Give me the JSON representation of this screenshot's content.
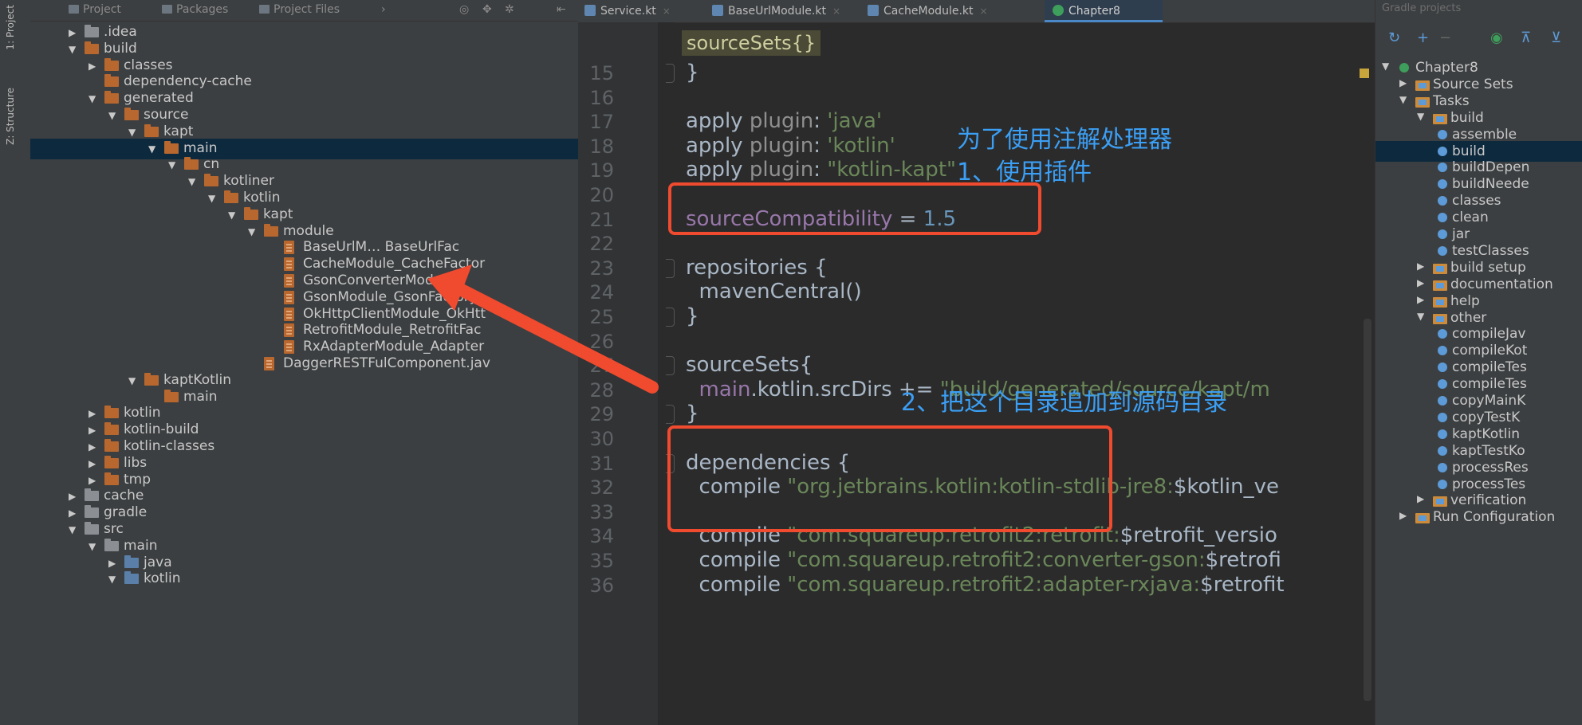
{
  "left_strip": {
    "project_label": "1: Project",
    "structure_label": "Z: Structure"
  },
  "project_panel": {
    "tabs": [
      "Project",
      "Packages",
      "Project Files"
    ],
    "tree": [
      {
        "label": ".idea",
        "arrow": "▶",
        "folder": "gray"
      },
      {
        "label": "build",
        "arrow": "▼",
        "folder": "orange"
      },
      {
        "label": "classes",
        "arrow": "▶",
        "folder": "orange"
      },
      {
        "label": "dependency-cache",
        "arrow": "",
        "folder": "orange"
      },
      {
        "label": "generated",
        "arrow": "▼",
        "folder": "orange"
      },
      {
        "label": "source",
        "arrow": "▼",
        "folder": "orange"
      },
      {
        "label": "kapt",
        "arrow": "▼",
        "folder": "orange"
      },
      {
        "label": "main",
        "arrow": "▼",
        "folder": "orange",
        "selected": true
      },
      {
        "label": "cn",
        "arrow": "▼",
        "folder": "orange"
      },
      {
        "label": "kotliner",
        "arrow": "▼",
        "folder": "orange"
      },
      {
        "label": "kotlin",
        "arrow": "▼",
        "folder": "orange"
      },
      {
        "label": "kapt",
        "arrow": "▼",
        "folder": "orange"
      },
      {
        "label": "module",
        "arrow": "▼",
        "folder": "orange"
      },
      {
        "label": "BaseUrlM… BaseUrlFac",
        "arrow": "",
        "folder": "file"
      },
      {
        "label": "CacheModule_CacheFactor",
        "arrow": "",
        "folder": "file"
      },
      {
        "label": "GsonConverterModule_",
        "arrow": "",
        "folder": "file"
      },
      {
        "label": "GsonModule_GsonFactory.",
        "arrow": "",
        "folder": "file"
      },
      {
        "label": "OkHttpClientModule_OkHtt",
        "arrow": "",
        "folder": "file"
      },
      {
        "label": "RetrofitModule_RetrofitFac",
        "arrow": "",
        "folder": "file"
      },
      {
        "label": "RxAdapterModule_Adapter",
        "arrow": "",
        "folder": "file"
      },
      {
        "label": "DaggerRESTFulComponent.jav",
        "arrow": "",
        "folder": "file"
      },
      {
        "label": "kaptKotlin",
        "arrow": "▼",
        "folder": "orange"
      },
      {
        "label": "main",
        "arrow": "",
        "folder": "orange"
      },
      {
        "label": "kotlin",
        "arrow": "▶",
        "folder": "orange"
      },
      {
        "label": "kotlin-build",
        "arrow": "▶",
        "folder": "orange"
      },
      {
        "label": "kotlin-classes",
        "arrow": "▶",
        "folder": "orange"
      },
      {
        "label": "libs",
        "arrow": "▶",
        "folder": "orange"
      },
      {
        "label": "tmp",
        "arrow": "▶",
        "folder": "orange"
      },
      {
        "label": "cache",
        "arrow": "▶",
        "folder": "gray"
      },
      {
        "label": "gradle",
        "arrow": "▶",
        "folder": "gray"
      },
      {
        "label": "src",
        "arrow": "▼",
        "folder": "gray"
      },
      {
        "label": "main",
        "arrow": "▼",
        "folder": "gray"
      },
      {
        "label": "java",
        "arrow": "▶",
        "folder": "blue"
      },
      {
        "label": "kotlin",
        "arrow": "▼",
        "folder": "blue"
      }
    ]
  },
  "editor": {
    "tabs": [
      {
        "label": "Service.kt",
        "active": false
      },
      {
        "label": "BaseUrlModule.kt",
        "active": false
      },
      {
        "label": "CacheModule.kt",
        "active": false
      },
      {
        "label": "Chapter8",
        "active": true
      }
    ],
    "breadcrumb": "sourceSets{}",
    "lines": [
      {
        "num": "15",
        "html": "}"
      },
      {
        "num": "16",
        "html": ""
      },
      {
        "num": "17",
        "html": "apply <span class='c-gray'>plugin</span>: <span class='c-green'>'java'</span>"
      },
      {
        "num": "18",
        "html": "apply <span class='c-gray'>plugin</span>: <span class='c-green'>'kotlin'</span>"
      },
      {
        "num": "19",
        "html": "apply <span class='c-gray'>plugin</span>: <span class='c-green'>\"kotlin-kapt\"</span>"
      },
      {
        "num": "20",
        "html": ""
      },
      {
        "num": "21",
        "html": "<span class='c-purple'>sourceCompatibility</span> = <span class='c-blue'>1.5</span>"
      },
      {
        "num": "22",
        "html": ""
      },
      {
        "num": "23",
        "html": "repositories {"
      },
      {
        "num": "24",
        "html": "&nbsp;&nbsp;mavenCentral()"
      },
      {
        "num": "25",
        "html": "}"
      },
      {
        "num": "26",
        "html": ""
      },
      {
        "num": "27",
        "html": "sourceSets{"
      },
      {
        "num": "28",
        "html": "&nbsp;&nbsp;<span class='c-purple'>main</span>.kotlin.srcDirs += <span class='c-green'>\"build/generated/source/kapt/m</span>"
      },
      {
        "num": "29",
        "html": "}"
      },
      {
        "num": "30",
        "html": ""
      },
      {
        "num": "31",
        "html": "dependencies {"
      },
      {
        "num": "32",
        "html": "&nbsp;&nbsp;compile <span class='c-green'>\"org.jetbrains.kotlin:kotlin-stdlib-jre8:</span>$kotlin_ve"
      },
      {
        "num": "33",
        "html": ""
      },
      {
        "num": "34",
        "html": "&nbsp;&nbsp;compile <span class='c-green'>\"com.squareup.retrofit2:retrofit:</span>$retrofit_versio"
      },
      {
        "num": "35",
        "html": "&nbsp;&nbsp;compile <span class='c-green'>\"com.squareup.retrofit2:converter-gson:</span>$retrofi"
      },
      {
        "num": "36",
        "html": "&nbsp;&nbsp;compile <span class='c-green'>\"com.squareup.retrofit2:adapter-rxjava:</span>$retrofit"
      }
    ],
    "annotations": {
      "title": "为了使用注解处理器",
      "step1": "1、使用插件",
      "step2": "2、把这个目录追加到源码目录"
    }
  },
  "gradle_panel": {
    "title": "Gradle projects",
    "tree": [
      {
        "label": "Chapter8",
        "arrow": "▼",
        "kind": "project"
      },
      {
        "label": "Source Sets",
        "arrow": "▶",
        "kind": "folder"
      },
      {
        "label": "Tasks",
        "arrow": "▼",
        "kind": "folder"
      },
      {
        "label": "build",
        "arrow": "▼",
        "kind": "folder"
      },
      {
        "label": "assemble",
        "arrow": "",
        "kind": "task"
      },
      {
        "label": "build",
        "arrow": "",
        "kind": "task",
        "selected": true
      },
      {
        "label": "buildDepen",
        "arrow": "",
        "kind": "task"
      },
      {
        "label": "buildNeede",
        "arrow": "",
        "kind": "task"
      },
      {
        "label": "classes",
        "arrow": "",
        "kind": "task"
      },
      {
        "label": "clean",
        "arrow": "",
        "kind": "task"
      },
      {
        "label": "jar",
        "arrow": "",
        "kind": "task"
      },
      {
        "label": "testClasses",
        "arrow": "",
        "kind": "task"
      },
      {
        "label": "build setup",
        "arrow": "▶",
        "kind": "folder"
      },
      {
        "label": "documentation",
        "arrow": "▶",
        "kind": "folder"
      },
      {
        "label": "help",
        "arrow": "▶",
        "kind": "folder"
      },
      {
        "label": "other",
        "arrow": "▼",
        "kind": "folder"
      },
      {
        "label": "compileJav",
        "arrow": "",
        "kind": "task"
      },
      {
        "label": "compileKot",
        "arrow": "",
        "kind": "task"
      },
      {
        "label": "compileTes",
        "arrow": "",
        "kind": "task"
      },
      {
        "label": "compileTes",
        "arrow": "",
        "kind": "task"
      },
      {
        "label": "copyMainK",
        "arrow": "",
        "kind": "task"
      },
      {
        "label": "copyTestK",
        "arrow": "",
        "kind": "task"
      },
      {
        "label": "kaptKotlin",
        "arrow": "",
        "kind": "task"
      },
      {
        "label": "kaptTestKo",
        "arrow": "",
        "kind": "task"
      },
      {
        "label": "processRes",
        "arrow": "",
        "kind": "task"
      },
      {
        "label": "processTes",
        "arrow": "",
        "kind": "task"
      },
      {
        "label": "verification",
        "arrow": "▶",
        "kind": "folder"
      },
      {
        "label": "Run Configuration",
        "arrow": "▶",
        "kind": "folder"
      }
    ]
  }
}
